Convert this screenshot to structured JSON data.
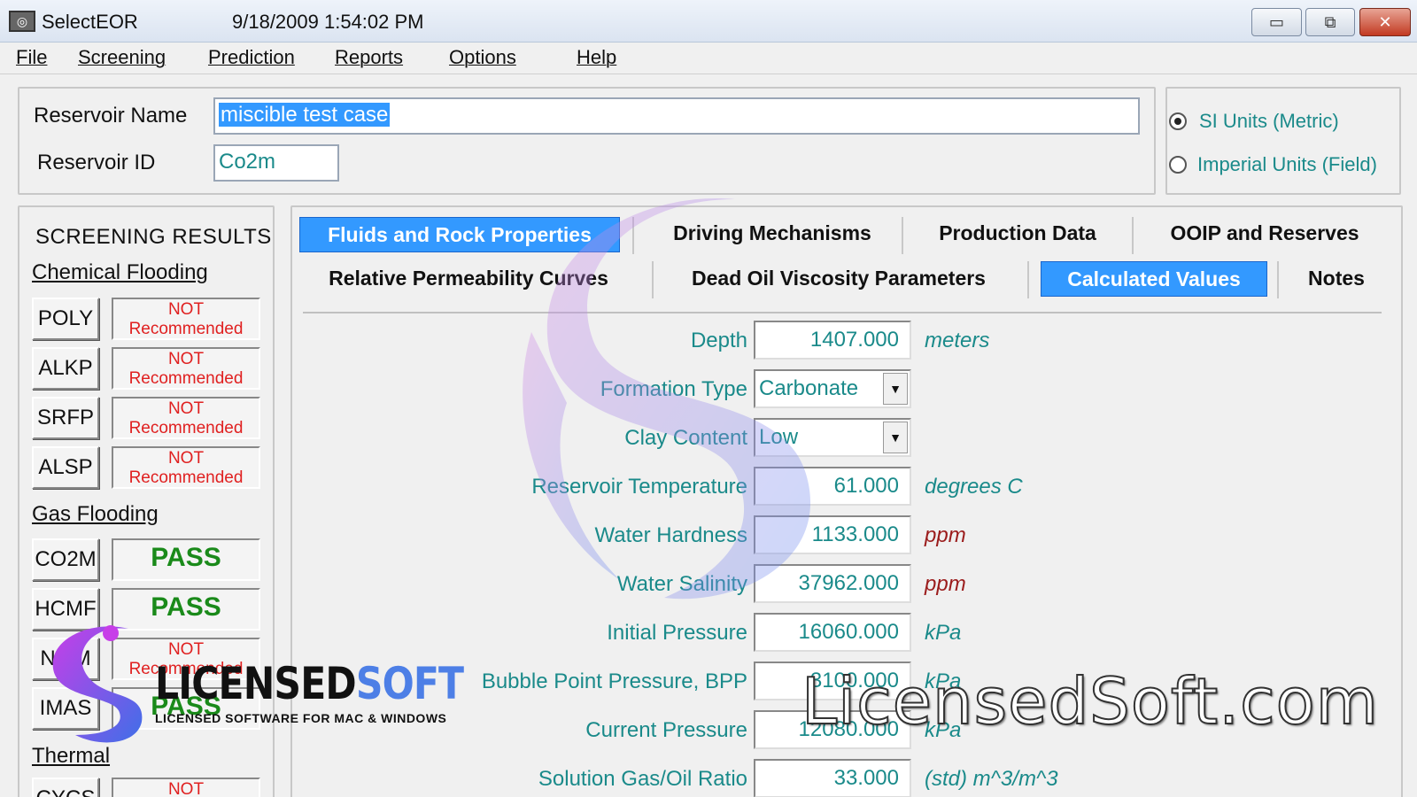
{
  "window": {
    "title": "SelectEOR",
    "timestamp": "9/18/2009 1:54:02 PM",
    "min_glyph": "▭",
    "max_glyph": "⧉",
    "close_glyph": "✕"
  },
  "menu": [
    "File",
    "Screening",
    "Prediction",
    "Reports",
    "Options",
    "Help"
  ],
  "reservoir": {
    "name_label": "Reservoir Name",
    "name_value": "miscible test case",
    "id_label": "Reservoir ID",
    "id_value": "Co2m"
  },
  "units": {
    "options": [
      {
        "label": "SI Units (Metric)",
        "selected": true
      },
      {
        "label": "Imperial Units (Field)",
        "selected": false
      }
    ]
  },
  "screening": {
    "title": "SCREENING RESULTS",
    "sections": [
      {
        "name": "Chemical Flooding"
      },
      {
        "name": "Gas Flooding"
      },
      {
        "name": "Thermal"
      }
    ],
    "items": [
      {
        "code": "POLY",
        "result_line1": "NOT",
        "result_line2": "Recommended"
      },
      {
        "code": "ALKP",
        "result_line1": "NOT",
        "result_line2": "Recommended"
      },
      {
        "code": "SRFP",
        "result_line1": "NOT",
        "result_line2": "Recommended"
      },
      {
        "code": "ALSP",
        "result_line1": "NOT",
        "result_line2": "Recommended"
      },
      {
        "code": "CO2M",
        "result": "PASS"
      },
      {
        "code": "HCMF",
        "result": "PASS"
      },
      {
        "code": "NI2M",
        "result_line1": "NOT",
        "result_line2": "Recommended"
      },
      {
        "code": "IMAS",
        "result": "PASS"
      },
      {
        "code": "CYCS",
        "result_line1": "NOT"
      }
    ]
  },
  "tabs": {
    "row1": [
      "Fluids and Rock Properties",
      "Driving Mechanisms",
      "Production Data",
      "OOIP and Reserves"
    ],
    "row2": [
      "Relative Permeability Curves",
      "Dead Oil Viscosity Parameters",
      "Calculated Values",
      "Notes"
    ],
    "active": [
      "Fluids and Rock Properties",
      "Calculated Values"
    ]
  },
  "properties": [
    {
      "label": "Depth",
      "value": "1407.000",
      "unit": "meters",
      "unit_color": "#1a8a8a"
    },
    {
      "label": "Formation Type",
      "value": "Carbonate",
      "type": "select"
    },
    {
      "label": "Clay Content",
      "value": "Low",
      "type": "select"
    },
    {
      "label": "Reservoir Temperature",
      "value": "61.000",
      "unit": "degrees C",
      "unit_color": "#1a8a8a"
    },
    {
      "label": "Water Hardness",
      "value": "1133.000",
      "unit": "ppm",
      "unit_color": "#9b1c1c"
    },
    {
      "label": "Water Salinity",
      "value": "37962.000",
      "unit": "ppm",
      "unit_color": "#9b1c1c"
    },
    {
      "label": "Initial Pressure",
      "value": "16060.000",
      "unit": "kPa",
      "unit_color": "#1a8a8a"
    },
    {
      "label": "Bubble Point Pressure, BPP",
      "value": "3100.000",
      "unit": "kPa",
      "unit_color": "#1a8a8a"
    },
    {
      "label": "Current Pressure",
      "value": "12080.000",
      "unit": "kPa",
      "unit_color": "#1a8a8a"
    },
    {
      "label": "Solution Gas/Oil Ratio",
      "value": "33.000",
      "unit": "(std) m^3/m^3",
      "unit_color": "#1a8a8a"
    }
  ],
  "watermarks": {
    "logo_main": "LICENSED",
    "logo_accent": "SOFT",
    "logo_sub": "LICENSED SOFTWARE FOR MAC & WINDOWS",
    "site": "LicensedSoft.com"
  },
  "colors": {
    "accent": "#3399ff",
    "teal_text": "#1a8a8a",
    "not_recommended": "#e02020",
    "pass": "#1a8a1a"
  }
}
